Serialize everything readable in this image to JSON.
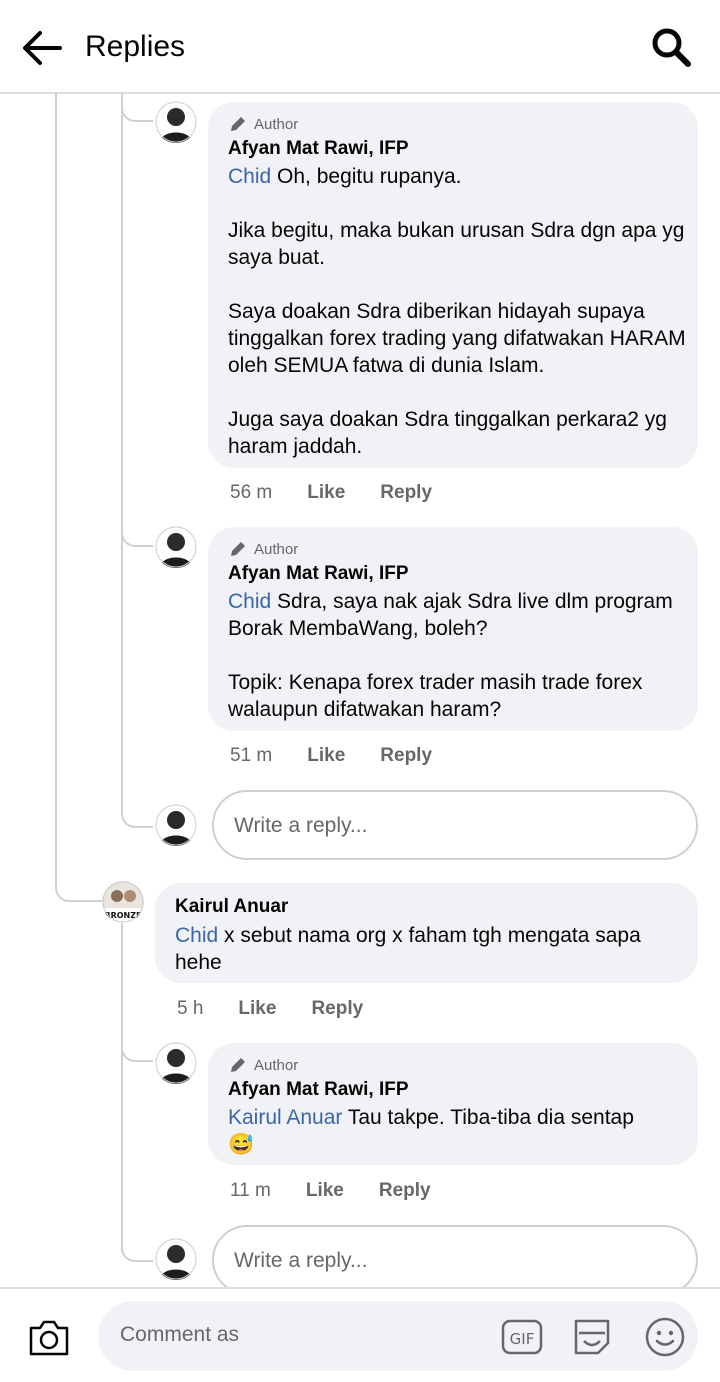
{
  "header": {
    "title": "Replies"
  },
  "comments": [
    {
      "badge": "Author",
      "name": "Afyan Mat Rawi, IFP",
      "mention": "Chid",
      "text": " Oh, begitu rupanya.\n\nJika begitu, maka bukan urusan Sdra dgn apa yg saya buat.\n\nSaya doakan Sdra diberikan hidayah supaya tinggalkan forex trading yang difatwakan HARAM oleh SEMUA fatwa di dunia Islam.\n\nJuga saya doakan Sdra tinggalkan perkara2 yg haram jaddah.",
      "time": "56 m",
      "like": "Like",
      "reply": "Reply"
    },
    {
      "badge": "Author",
      "name": "Afyan Mat Rawi, IFP",
      "mention": "Chid",
      "text": " Sdra, saya nak ajak Sdra live dlm program Borak MembaWang, boleh?\n\nTopik: Kenapa forex trader masih trade forex walaupun difatwakan haram?",
      "time": "51 m",
      "like": "Like",
      "reply": "Reply"
    },
    {
      "name": "Kairul Anuar",
      "mention": "Chid",
      "text": " x sebut nama org x faham tgh mengata sapa hehe",
      "time": "5 h",
      "like": "Like",
      "reply": "Reply"
    },
    {
      "badge": "Author",
      "name": "Afyan Mat Rawi, IFP",
      "mention": "Kairul Anuar",
      "text": " Tau takpe. Tiba-tiba dia sentap",
      "emoji": "😅",
      "time": "11 m",
      "like": "Like",
      "reply": "Reply"
    }
  ],
  "reply_placeholder": "Write a reply...",
  "avatar_badge_text": "BRONZE",
  "footer": {
    "placeholder": "Comment as"
  },
  "colors": {
    "mention": "#3b66a8",
    "bubble": "#f0f2f5",
    "secondary": "#65676b"
  },
  "icons": [
    "back-arrow-icon",
    "search-icon",
    "camera-icon",
    "gif-icon",
    "sticker-icon",
    "emoji-icon",
    "pencil-icon"
  ]
}
